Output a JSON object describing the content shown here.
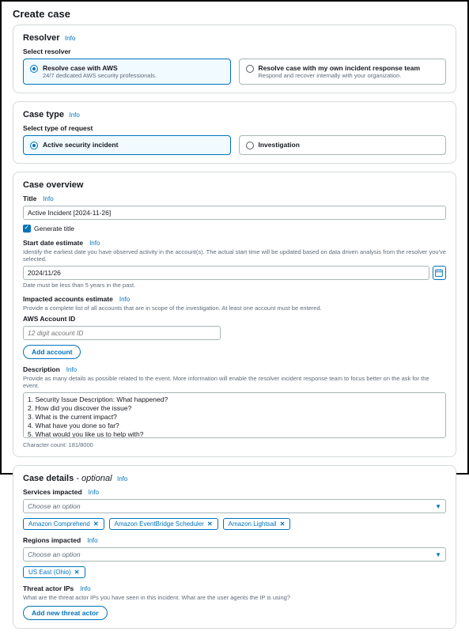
{
  "page_title": "Create case",
  "info_label": "Info",
  "resolver": {
    "heading": "Resolver",
    "select_label": "Select resolver",
    "options": [
      {
        "title": "Resolve case with AWS",
        "desc": "24/7 dedicated AWS security professionals."
      },
      {
        "title": "Resolve case with my own incident response team",
        "desc": "Respond and recover internally with your organization."
      }
    ]
  },
  "case_type": {
    "heading": "Case type",
    "select_label": "Select type of request",
    "options": [
      {
        "title": "Active security incident"
      },
      {
        "title": "Investigation"
      }
    ]
  },
  "overview": {
    "heading": "Case overview",
    "title_label": "Title",
    "title_value": "Active Incident [2024-11-26]",
    "generate_title": "Generate title",
    "start_date_label": "Start date estimate",
    "start_date_hint": "Identify the earliest date you have observed activity in the account(s). The actual start time will be updated based on data driven analysis from the resolver you've selected.",
    "start_date_value": "2024/11/26",
    "start_date_constraint": "Date must be less than 5 years in the past.",
    "accounts_label": "Impacted accounts estimate",
    "accounts_hint": "Provide a complete list of all accounts that are in scope of the investigation. At least one account must be entered.",
    "account_id_label": "AWS Account ID",
    "account_id_placeholder": "12 digit account ID",
    "add_account": "Add account",
    "description_label": "Description",
    "description_hint": "Provide as many details as possible related to the event. More information will enable the resolver incident response team to focus better on the ask for the event.",
    "description_value": "1. Security Issue Description: What happened?\n2. How did you discover the issue?\n3. What is the current impact?\n4. What have you done so far?\n5. What would you like us to help with?",
    "char_count": "Character count: 181/8000"
  },
  "details": {
    "heading_main": "Case details",
    "heading_suffix": " - optional",
    "services_label": "Services impacted",
    "choose_option": "Choose an option",
    "service_tokens": [
      "Amazon Comprehend",
      "Amazon EventBridge Scheduler",
      "Amazon Lightsail"
    ],
    "regions_label": "Regions impacted",
    "region_tokens": [
      "US East (Ohio)"
    ],
    "threat_label": "Threat actor IPs",
    "threat_hint": "What are the threat actor IPs you have seen in this incident. What are the user agents the IP is using?",
    "add_threat": "Add new threat actor"
  }
}
